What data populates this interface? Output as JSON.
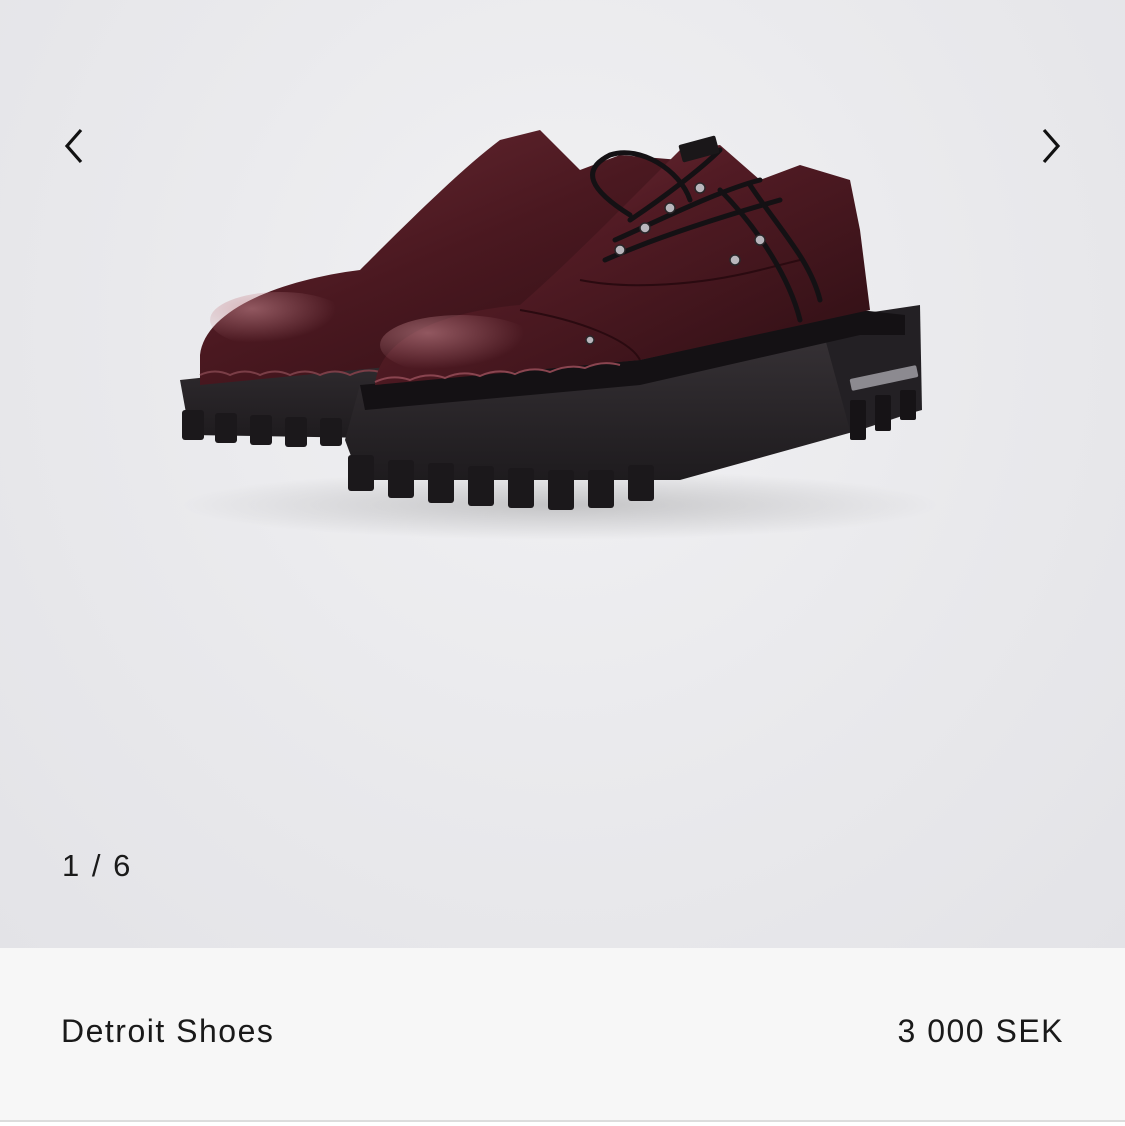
{
  "gallery": {
    "counter": "1 / 6",
    "image_alt": "Burgundy patent leather lace-up shoes with chunky black lug soles"
  },
  "icons": {
    "prev": "chevron-left-icon",
    "next": "chevron-right-icon"
  },
  "product": {
    "name": "Detroit Shoes",
    "price": "3 000 SEK"
  },
  "colors": {
    "text": "#1a1a1a",
    "gallery_bg": "#ebebee",
    "info_bg": "#f7f7f7",
    "leather": "#4a1820",
    "sole": "#2a2629"
  }
}
